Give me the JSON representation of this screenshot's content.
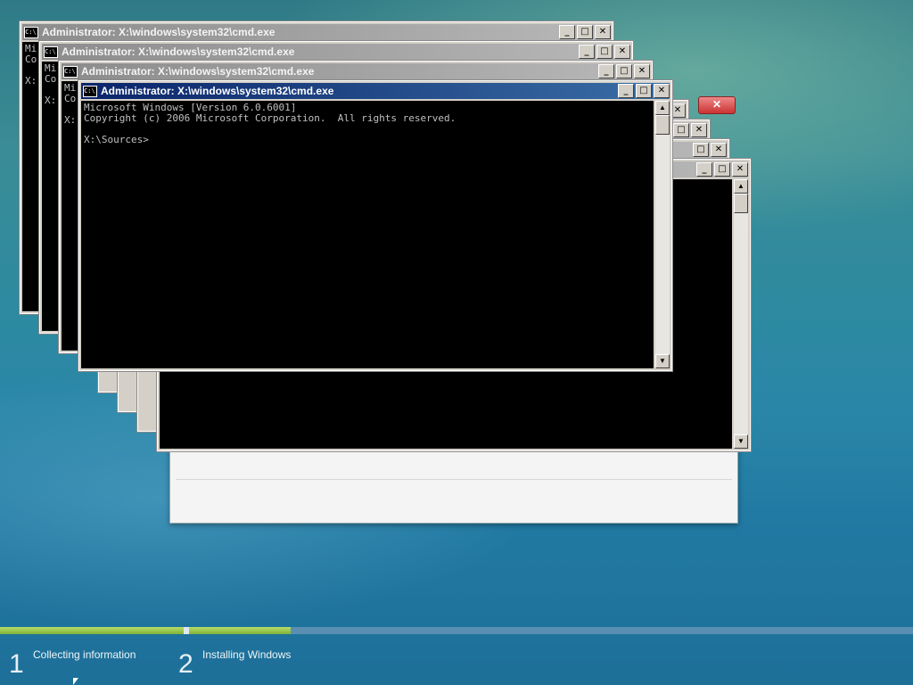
{
  "cmd_windows": [
    {
      "title": "Administrator: X:\\windows\\system32\\cmd.exe",
      "lines": [
        "Mi",
        "Co",
        "",
        "X:"
      ]
    },
    {
      "title": "Administrator: X:\\windows\\system32\\cmd.exe",
      "lines": [
        "Mi",
        "Co",
        "",
        "X:"
      ]
    },
    {
      "title": "Administrator: X:\\windows\\system32\\cmd.exe",
      "lines": [
        "Mi",
        "Co",
        "",
        "X:"
      ]
    },
    {
      "title": "Administrator: X:\\windows\\system32\\cmd.exe",
      "lines": [
        "Microsoft Windows [Version 6.0.6001]",
        "Copyright (c) 2006 Microsoft Corporation.  All rights reserved.",
        "",
        "X:\\Sources>"
      ]
    }
  ],
  "window_buttons": {
    "minimize": "_",
    "maximize": "□",
    "close": "✕"
  },
  "sys_icon_text": "C:\\",
  "scroll": {
    "up": "▲",
    "down": "▼"
  },
  "setup_close": "✕",
  "progress": {
    "step1_fraction": 1.0,
    "step2_fraction": 0.14
  },
  "steps": [
    {
      "number": "1",
      "label": "Collecting information"
    },
    {
      "number": "2",
      "label": "Installing Windows"
    }
  ]
}
